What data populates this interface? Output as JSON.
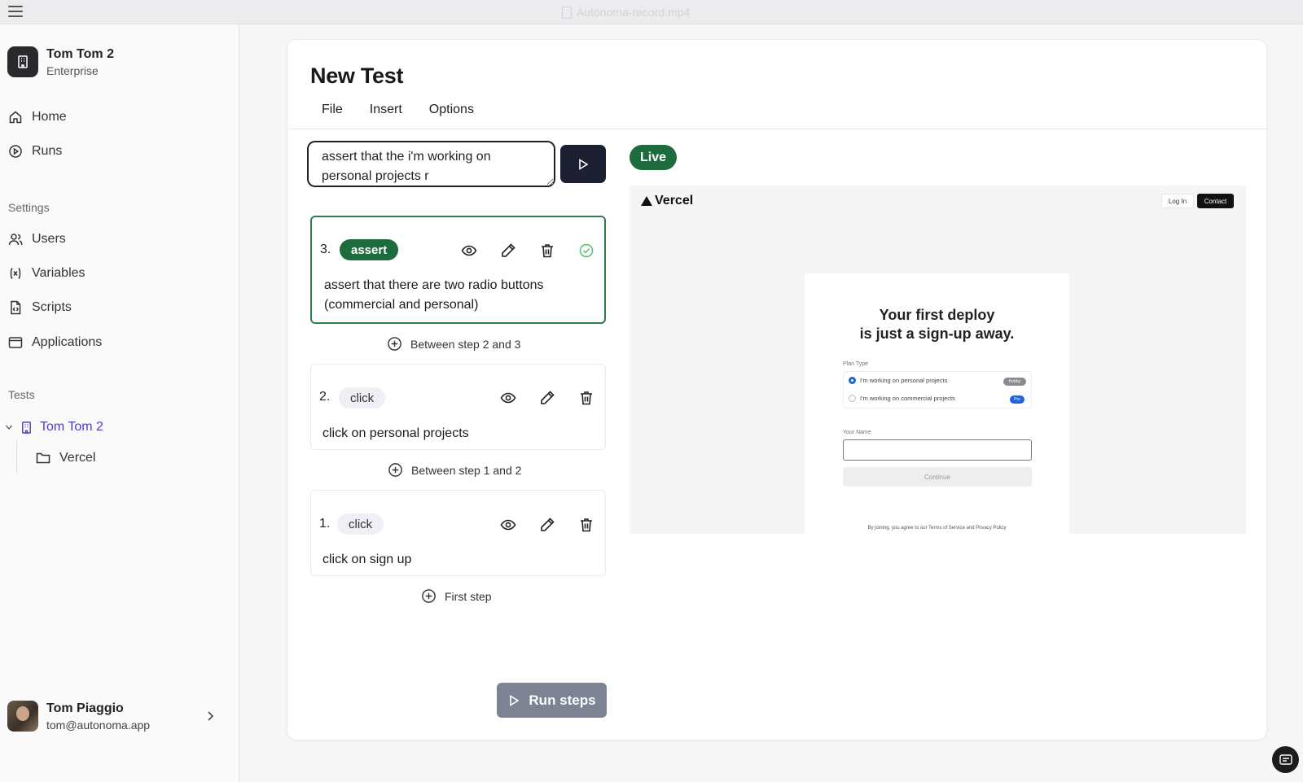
{
  "window": {
    "title": "Autonoma-record.mp4"
  },
  "org": {
    "name": "Tom Tom 2",
    "plan": "Enterprise"
  },
  "nav": {
    "home": "Home",
    "runs": "Runs"
  },
  "settings": {
    "label": "Settings",
    "users": "Users",
    "variables": "Variables",
    "scripts": "Scripts",
    "applications": "Applications"
  },
  "tests": {
    "label": "Tests",
    "app": "Tom Tom 2",
    "folder": "Vercel"
  },
  "user": {
    "name": "Tom Piaggio",
    "email": "tom@autonoma.app"
  },
  "page": {
    "title": "New Test",
    "menu": {
      "file": "File",
      "insert": "Insert",
      "options": "Options"
    }
  },
  "prompt": {
    "value": "assert that the i'm working on personal projects r"
  },
  "steps": [
    {
      "number": "3.",
      "type": "assert",
      "text": "assert that there are two radio buttons (commercial and personal)"
    },
    {
      "number": "2.",
      "type": "click",
      "text": "click on personal projects"
    },
    {
      "number": "1.",
      "type": "click",
      "text": "click on sign up"
    }
  ],
  "inserts": {
    "between_2_3": "Between step 2 and 3",
    "between_1_2": "Between step 1 and 2",
    "first": "First step"
  },
  "run_button": "Run steps",
  "live_badge": "Live",
  "preview": {
    "brand": "Vercel",
    "login": "Log In",
    "contact": "Contact",
    "headline_1": "Your first deploy",
    "headline_2": "is just a sign-up away.",
    "plan_type_label": "Plan Type",
    "plan_personal": "I'm working on personal projects",
    "plan_personal_tag": "Hobby",
    "plan_commercial": "I'm working on commercial projects",
    "plan_commercial_tag": "Pro",
    "name_label": "Your Name",
    "continue": "Continue",
    "terms": "By joining, you agree to our Terms of Service and Privacy Policy"
  },
  "colors": {
    "accent_green": "#1e6b3d",
    "send_button": "#1d1f33",
    "link_blue": "#4a3fc8"
  }
}
